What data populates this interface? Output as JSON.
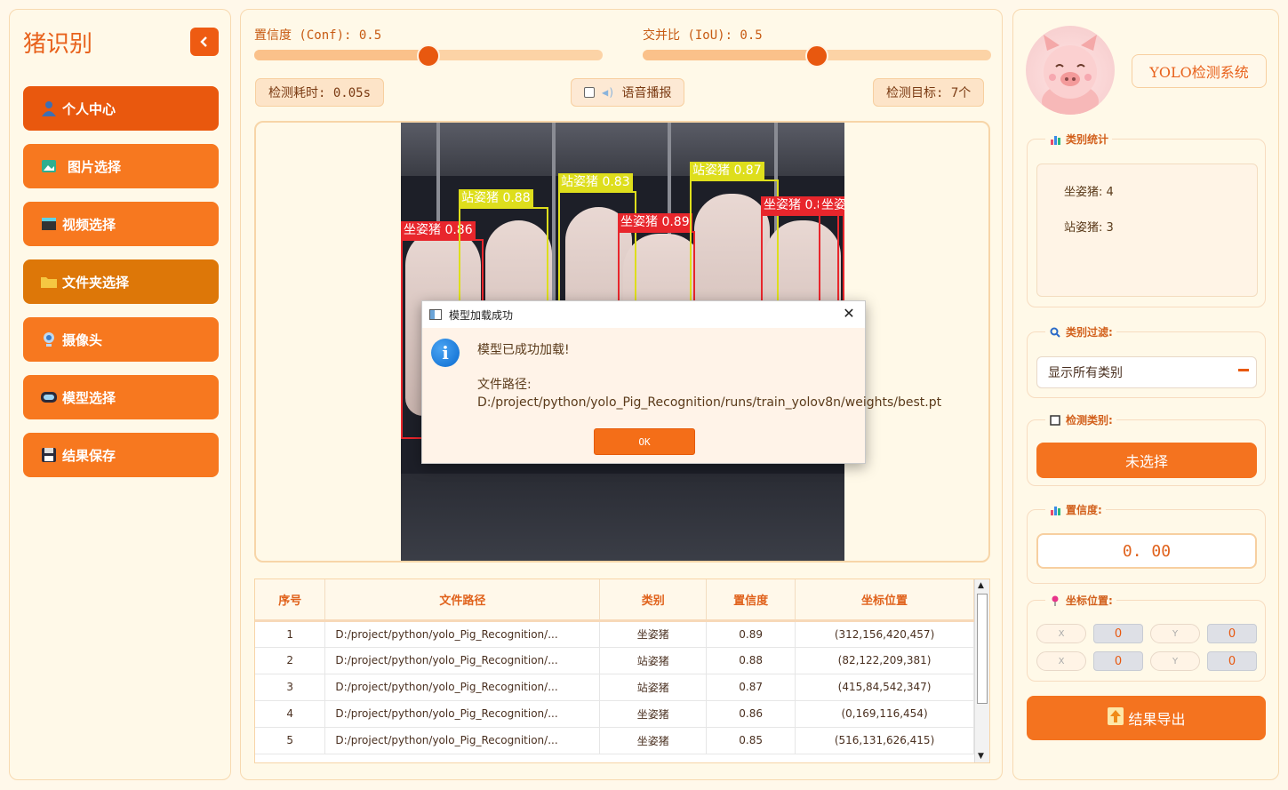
{
  "app": {
    "title": "猪识别",
    "system_title": "YOLO检测系统"
  },
  "nav": [
    {
      "label": "个人中心",
      "icon": "user-icon"
    },
    {
      "label": "图片选择",
      "icon": "image-icon"
    },
    {
      "label": "视频选择",
      "icon": "clapperboard-icon"
    },
    {
      "label": "文件夹选择",
      "icon": "folder-icon"
    },
    {
      "label": "摄像头",
      "icon": "webcam-icon"
    },
    {
      "label": "模型选择",
      "icon": "model-icon"
    },
    {
      "label": "结果保存",
      "icon": "floppy-disk-icon"
    }
  ],
  "controls": {
    "conf_label": "置信度 (Conf): 0.5",
    "conf_value": 0.5,
    "iou_label": "交并比 (IoU): 0.5",
    "iou_value": 0.5,
    "time_label": "检测耗时: 0.05s",
    "voice_label": "语音播报",
    "target_label": "检测目标: 7个"
  },
  "detections_overlay": [
    {
      "label": "坐姿猪 0.86",
      "color": "red"
    },
    {
      "label": "站姿猪 0.88",
      "color": "yellow"
    },
    {
      "label": "站姿猪 0.83",
      "color": "yellow"
    },
    {
      "label": "坐姿猪 0.89",
      "color": "red"
    },
    {
      "label": "站姿猪 0.87",
      "color": "yellow"
    },
    {
      "label": "坐姿猪 0.85",
      "color": "red"
    },
    {
      "label": "坐姿",
      "color": "red"
    }
  ],
  "dialog": {
    "title": "模型加载成功",
    "message": "模型已成功加载!",
    "path": "文件路径: D:/project/python/yolo_Pig_Recognition/runs/train_yolov8n/weights/best.pt",
    "ok_label": "OK"
  },
  "table": {
    "headers": [
      "序号",
      "文件路径",
      "类别",
      "置信度",
      "坐标位置"
    ],
    "rows": [
      [
        "1",
        "D:/project/python/yolo_Pig_Recognition/...",
        "坐姿猪",
        "0.89",
        "(312,156,420,457)"
      ],
      [
        "2",
        "D:/project/python/yolo_Pig_Recognition/...",
        "站姿猪",
        "0.88",
        "(82,122,209,381)"
      ],
      [
        "3",
        "D:/project/python/yolo_Pig_Recognition/...",
        "站姿猪",
        "0.87",
        "(415,84,542,347)"
      ],
      [
        "4",
        "D:/project/python/yolo_Pig_Recognition/...",
        "坐姿猪",
        "0.86",
        "(0,169,116,454)"
      ],
      [
        "5",
        "D:/project/python/yolo_Pig_Recognition/...",
        "坐姿猪",
        "0.85",
        "(516,131,626,415)"
      ]
    ]
  },
  "right": {
    "stats_title": "类别统计",
    "stats": [
      "坐姿猪: 4",
      "站姿猪: 3"
    ],
    "filter_title": "类别过滤:",
    "filter_value": "显示所有类别",
    "detect_class_title": "检测类别:",
    "detect_class_button": "未选择",
    "conf_title": "置信度:",
    "conf_value": "0. 00",
    "coord_title": "坐标位置:",
    "coord_labels": [
      "X",
      "Y",
      "X",
      "Y"
    ],
    "coord_values": [
      "0",
      "0",
      "0",
      "0"
    ],
    "export_label": "结果导出"
  },
  "colors": {
    "accent": "#f4731f",
    "accent_dark": "#e8580f",
    "panel_bg": "#fff9e8"
  }
}
